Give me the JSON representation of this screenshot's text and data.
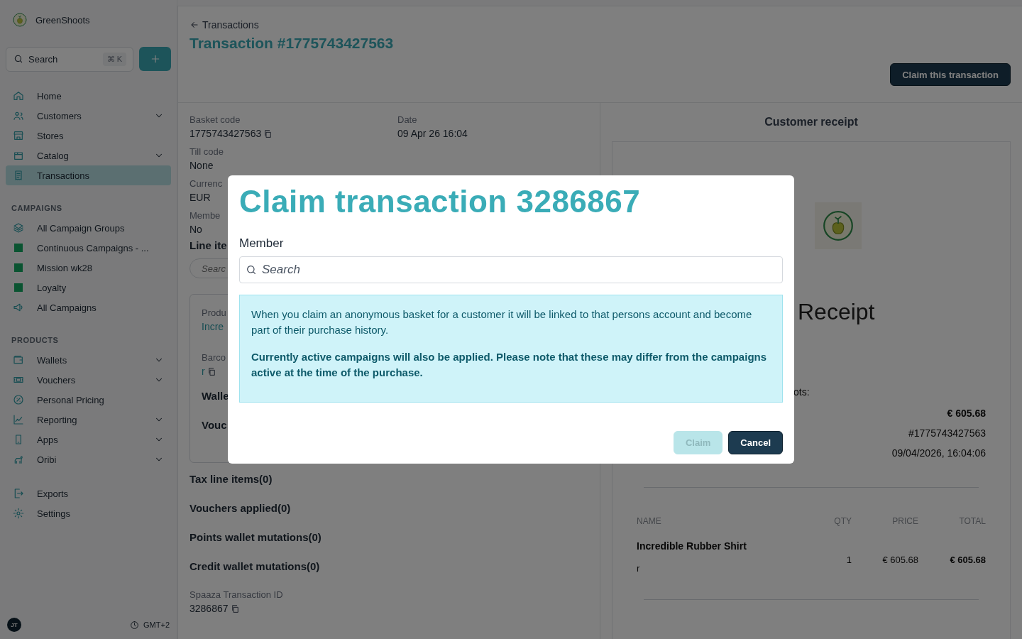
{
  "sidebar": {
    "brand": "GreenShoots",
    "search": {
      "placeholder": "Search",
      "shortcut": "⌘ K"
    },
    "groups": [
      {
        "items": [
          {
            "label": "Home",
            "kind": "link",
            "expandable": false,
            "selected": false
          },
          {
            "label": "Customers",
            "kind": "link",
            "expandable": true,
            "selected": false
          },
          {
            "label": "Stores",
            "kind": "link",
            "expandable": false,
            "selected": false
          },
          {
            "label": "Catalog",
            "kind": "link",
            "expandable": true,
            "selected": false
          },
          {
            "label": "Transactions",
            "kind": "link",
            "expandable": false,
            "selected": true
          }
        ]
      },
      {
        "title": "CAMPAIGNS",
        "items": [
          {
            "label": "All Campaign Groups",
            "kind": "link",
            "expandable": false,
            "selected": false
          },
          {
            "label": "Continuous Campaigns - ...",
            "kind": "campaign",
            "expandable": false,
            "selected": false
          },
          {
            "label": "Mission wk28",
            "kind": "campaign",
            "expandable": false,
            "selected": false
          },
          {
            "label": "Loyalty",
            "kind": "campaign",
            "expandable": false,
            "selected": false
          },
          {
            "label": "All Campaigns",
            "kind": "link",
            "expandable": false,
            "selected": false
          }
        ]
      },
      {
        "title": "PRODUCTS",
        "items": [
          {
            "label": "Wallets",
            "kind": "link",
            "expandable": true,
            "selected": false
          },
          {
            "label": "Vouchers",
            "kind": "link",
            "expandable": true,
            "selected": false
          },
          {
            "label": "Personal Pricing",
            "kind": "link",
            "expandable": false,
            "selected": false
          },
          {
            "label": "Reporting",
            "kind": "link",
            "expandable": true,
            "selected": false
          },
          {
            "label": "Apps",
            "kind": "link",
            "expandable": true,
            "selected": false
          },
          {
            "label": "Oribi",
            "kind": "link",
            "expandable": true,
            "selected": false
          }
        ]
      },
      {
        "items": [
          {
            "label": "Exports",
            "kind": "link",
            "expandable": false,
            "selected": false
          },
          {
            "label": "Settings",
            "kind": "link",
            "expandable": false,
            "selected": false
          }
        ]
      }
    ],
    "footer": {
      "initials": "JT",
      "timezone": "GMT+2"
    }
  },
  "header": {
    "back_link": "Transactions",
    "title": "Transaction #1775743427563",
    "action": "Claim this transaction"
  },
  "details": {
    "fields": [
      {
        "label": "Basket code",
        "value": "1775743427563",
        "copyable": true
      },
      {
        "label": "Date",
        "value": "09 Apr 26 16:04",
        "copyable": false
      },
      {
        "label": "Till code",
        "value": "None",
        "copyable": false
      },
      {
        "label": "Currenc",
        "value": "EUR",
        "copyable": false
      },
      {
        "label": "Membe",
        "value": "No",
        "copyable": false
      }
    ],
    "line_items": {
      "heading": "Line ite",
      "search_placeholder": "Searc",
      "product_label": "Produ",
      "product_value": "Incre",
      "barcode_label": "Barco",
      "barcode_value": "r",
      "wallet_heading": "Walle",
      "voucher_heading": "Vouc"
    },
    "sections": [
      "Tax line items(0)",
      "Vouchers applied(0)",
      "Points wallet mutations(0)",
      "Credit wallet mutations(0)"
    ],
    "transaction_id": {
      "label": "Spaaza Transaction ID",
      "value": "3286867"
    }
  },
  "receipt": {
    "heading": "Customer receipt",
    "title": "Receipt",
    "intro": "ots:",
    "summary": [
      {
        "value": "€ 605.68",
        "bold": true
      },
      {
        "value": "#1775743427563",
        "bold": false
      },
      {
        "value": "09/04/2026, 16:04:06",
        "bold": false
      }
    ],
    "columns": [
      "NAME",
      "QTY",
      "PRICE",
      "TOTAL"
    ],
    "rows": [
      {
        "name": "Incredible Rubber Shirt",
        "detail": "r",
        "qty": "1",
        "price": "€ 605.68",
        "total": "€ 605.68"
      }
    ]
  },
  "modal": {
    "title": "Claim transaction 3286867",
    "field_label": "Member",
    "placeholder": "Search",
    "notice": "When you claim an anonymous basket for a customer it will be linked to that persons account and become part of their purchase history.",
    "notice_bold": "Currently active campaigns will also be applied. Please note that these may differ from the campaigns active at the time of the purchase.",
    "buttons": [
      {
        "label": "Claim",
        "kind": "primary",
        "disabled": true
      },
      {
        "label": "Cancel",
        "kind": "secondary",
        "disabled": false
      }
    ]
  }
}
